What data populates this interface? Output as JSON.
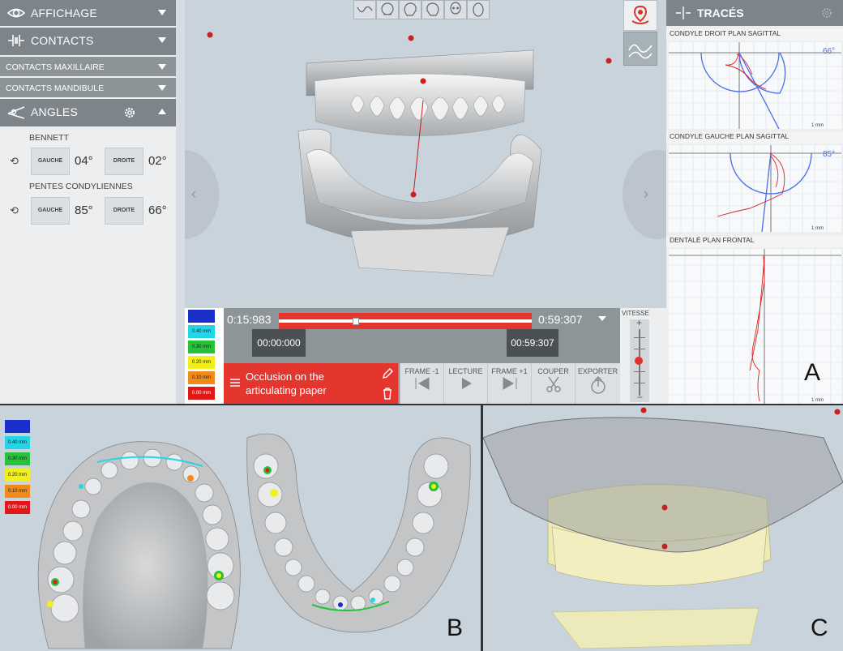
{
  "left_panel": {
    "affichage": "AFFICHAGE",
    "contacts": "CONTACTS",
    "contacts_maxillaire": "CONTACTS MAXILLAIRE",
    "contacts_mandibule": "CONTACTS MANDIBULE",
    "angles": "ANGLES",
    "bennett": "BENNETT",
    "pentes": "PENTES CONDYLIENNES",
    "gauche": "GAUCHE",
    "droite": "DROITE",
    "bennett_gauche": "04°",
    "bennett_droite": "02°",
    "pentes_gauche": "85°",
    "pentes_droite": "66°"
  },
  "player": {
    "start": "0:15:983",
    "end": "0:59:307",
    "cursor_left": "00:00:000",
    "cursor_right": "00:59:307",
    "clip_label": "Occlusion on the articulating paper",
    "progress": 0.3,
    "buttons": {
      "frame_prev": "FRAME -1",
      "lecture": "LECTURE",
      "frame_next": "FRAME +1",
      "couper": "COUPER",
      "exporter": "EXPORTER"
    },
    "vitesse": "VITESSE"
  },
  "scale": {
    "labels": [
      "",
      "0.40 mm",
      "0.30 mm",
      "0.20 mm",
      "0.10 mm",
      "0.00 mm"
    ],
    "colors": [
      "#1a2fc8",
      "#22d6e8",
      "#26c23a",
      "#f1ef1c",
      "#f08a1a",
      "#e01818"
    ]
  },
  "traces": {
    "title": "TRACÉS",
    "g1_title": "CONDYLE DROIT PLAN SAGITTAL",
    "g1_angle": "66°",
    "g2_title": "CONDYLE GAUCHE PLAN SAGITTAL",
    "g2_angle": "85°",
    "g3_title": "DENTALÉ PLAN FRONTAL",
    "unit": "1 mm"
  },
  "labels": {
    "a": "A",
    "b": "B",
    "c": "C"
  },
  "colors": {
    "accent": "#e2312e",
    "header": "#7d858a",
    "trace_blue": "#4a6ee6"
  }
}
